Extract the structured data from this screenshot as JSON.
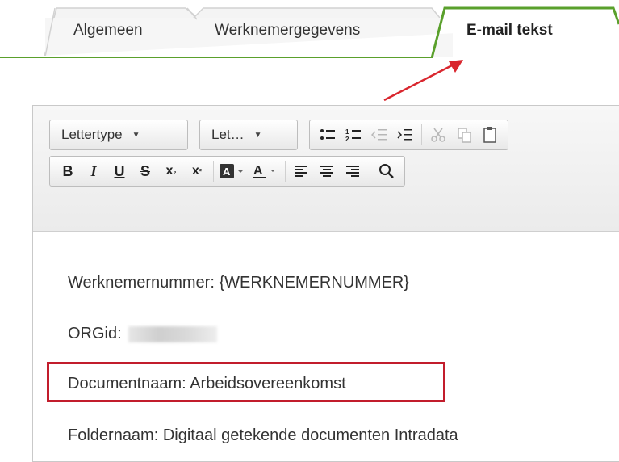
{
  "tabs": [
    {
      "label": "Algemeen",
      "active": false
    },
    {
      "label": "Werknemergegevens",
      "active": false
    },
    {
      "label": "E-mail tekst",
      "active": true
    }
  ],
  "toolbar": {
    "font_family_label": "Lettertype",
    "font_size_label": "Let…",
    "row1_icons": [
      "bulleted-list-icon",
      "numbered-list-icon",
      "decrease-indent-icon",
      "increase-indent-icon",
      "cut-icon",
      "copy-icon",
      "paste-icon"
    ],
    "row2_icons": [
      "bold-icon",
      "italic-icon",
      "underline-icon",
      "strikethrough-icon",
      "subscript-icon",
      "superscript-icon",
      "background-color-icon",
      "text-color-icon",
      "align-left-icon",
      "align-center-icon",
      "align-right-icon",
      "find-icon"
    ]
  },
  "content": {
    "lines": [
      "Werknemernummer: {WERKNEMERNUMMER}",
      "ORGid:",
      "Documentnaam: Arbeidsovereenkomst",
      "Foldernaam: Digitaal getekende documenten Intradata"
    ]
  },
  "colors": {
    "active_tab_border": "#5aa02c",
    "annotation_red": "#d9262e",
    "highlight_box": "#c21d2c"
  }
}
